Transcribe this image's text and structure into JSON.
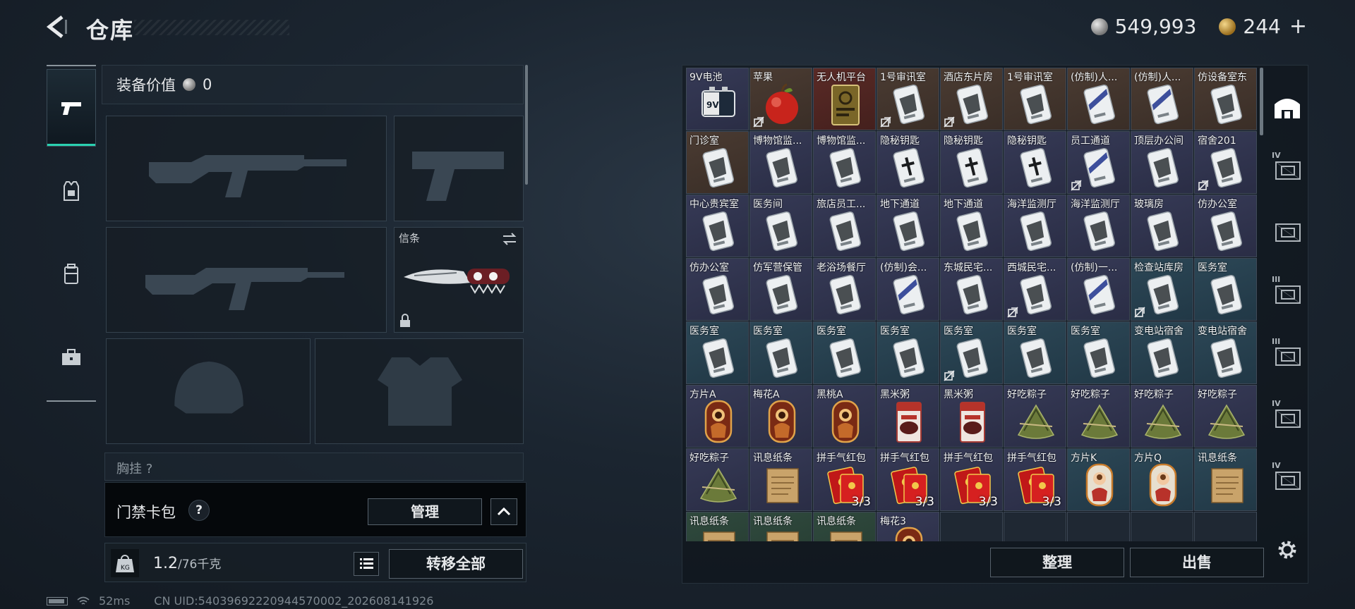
{
  "header": {
    "title": "仓库",
    "silver_amount": "549,993",
    "gold_amount": "244",
    "plus_label": "+"
  },
  "equipment": {
    "value_label": "装备价值",
    "value": "0",
    "melee_slot_label": "信条",
    "chest_hint": "胸挂 ?"
  },
  "keycard": {
    "label": "门禁卡包",
    "help": "?",
    "manage_label": "管理"
  },
  "weight": {
    "current": "1.2",
    "capacity": "/76千克",
    "transfer_all_label": "转移全部"
  },
  "status": {
    "ping": "52ms",
    "uid": "CN UID:5403969222094457000​2_202608141926"
  },
  "storage": {
    "sort_label": "整理",
    "sell_label": "出售",
    "items": [
      {
        "name": "9V电池",
        "bg": "purple",
        "art": "battery",
        "nolink": false,
        "count": ""
      },
      {
        "name": "苹果",
        "bg": "brown",
        "art": "apple",
        "nolink": true,
        "count": ""
      },
      {
        "name": "无人机平台",
        "bg": "red",
        "art": "drone",
        "nolink": false,
        "count": ""
      },
      {
        "name": "1号审讯室",
        "bg": "brown",
        "art": "card",
        "nolink": true,
        "count": ""
      },
      {
        "name": "酒店东片房",
        "bg": "brown",
        "art": "card",
        "nolink": true,
        "count": ""
      },
      {
        "name": "1号审讯室",
        "bg": "brown",
        "art": "card",
        "nolink": false,
        "count": ""
      },
      {
        "name": "(仿制)人...",
        "bg": "brown",
        "art": "card-blue",
        "nolink": false,
        "count": ""
      },
      {
        "name": "(仿制)人...",
        "bg": "brown",
        "art": "card-blue",
        "nolink": false,
        "count": ""
      },
      {
        "name": "仿设备室东",
        "bg": "brown",
        "art": "card",
        "nolink": false,
        "count": ""
      },
      {
        "name": "门诊室",
        "bg": "brown",
        "art": "card",
        "nolink": false,
        "count": ""
      },
      {
        "name": "博物馆监...",
        "bg": "purple",
        "art": "card",
        "nolink": false,
        "count": ""
      },
      {
        "name": "博物馆监...",
        "bg": "purple",
        "art": "card",
        "nolink": false,
        "count": ""
      },
      {
        "name": "隐秘钥匙",
        "bg": "purple",
        "art": "card-cross",
        "nolink": false,
        "count": ""
      },
      {
        "name": "隐秘钥匙",
        "bg": "purple",
        "art": "card-cross",
        "nolink": false,
        "count": ""
      },
      {
        "name": "隐秘钥匙",
        "bg": "purple",
        "art": "card-cross",
        "nolink": false,
        "count": ""
      },
      {
        "name": "员工通道",
        "bg": "purple",
        "art": "card-blue",
        "nolink": true,
        "count": ""
      },
      {
        "name": "顶层办公间",
        "bg": "purple",
        "art": "card",
        "nolink": false,
        "count": ""
      },
      {
        "name": "宿舍201",
        "bg": "purple",
        "art": "card",
        "nolink": true,
        "count": ""
      },
      {
        "name": "中心贵宾室",
        "bg": "purple",
        "art": "card",
        "nolink": false,
        "count": ""
      },
      {
        "name": "医务间",
        "bg": "purple",
        "art": "card",
        "nolink": false,
        "count": ""
      },
      {
        "name": "旅店员工...",
        "bg": "purple",
        "art": "card",
        "nolink": false,
        "count": ""
      },
      {
        "name": "地下通道",
        "bg": "purple",
        "art": "card",
        "nolink": false,
        "count": ""
      },
      {
        "name": "地下通道",
        "bg": "purple",
        "art": "card",
        "nolink": false,
        "count": ""
      },
      {
        "name": "海洋监测厅",
        "bg": "purple",
        "art": "card",
        "nolink": false,
        "count": ""
      },
      {
        "name": "海洋监测厅",
        "bg": "purple",
        "art": "card",
        "nolink": false,
        "count": ""
      },
      {
        "name": "玻璃房",
        "bg": "purple",
        "art": "card",
        "nolink": false,
        "count": ""
      },
      {
        "name": "仿办公室",
        "bg": "purple",
        "art": "card",
        "nolink": false,
        "count": ""
      },
      {
        "name": "仿办公室",
        "bg": "purple",
        "art": "card",
        "nolink": false,
        "count": ""
      },
      {
        "name": "仿军营保管",
        "bg": "purple",
        "art": "card",
        "nolink": false,
        "count": ""
      },
      {
        "name": "老浴场餐厅",
        "bg": "purple",
        "art": "card",
        "nolink": false,
        "count": ""
      },
      {
        "name": "(仿制)会...",
        "bg": "purple",
        "art": "card-blue",
        "nolink": false,
        "count": ""
      },
      {
        "name": "东城民宅...",
        "bg": "purple",
        "art": "card",
        "nolink": false,
        "count": ""
      },
      {
        "name": "西城民宅...",
        "bg": "purple",
        "art": "card",
        "nolink": true,
        "count": ""
      },
      {
        "name": "(仿制)一...",
        "bg": "purple",
        "art": "card-blue",
        "nolink": false,
        "count": ""
      },
      {
        "name": "检查站库房",
        "bg": "teal",
        "art": "card",
        "nolink": true,
        "count": ""
      },
      {
        "name": "医务室",
        "bg": "teal",
        "art": "card",
        "nolink": false,
        "count": ""
      },
      {
        "name": "医务室",
        "bg": "teal",
        "art": "card",
        "nolink": false,
        "count": ""
      },
      {
        "name": "医务室",
        "bg": "teal",
        "art": "card",
        "nolink": false,
        "count": ""
      },
      {
        "name": "医务室",
        "bg": "teal",
        "art": "card",
        "nolink": false,
        "count": ""
      },
      {
        "name": "医务室",
        "bg": "teal",
        "art": "card",
        "nolink": false,
        "count": ""
      },
      {
        "name": "医务室",
        "bg": "teal",
        "art": "card",
        "nolink": true,
        "count": ""
      },
      {
        "name": "医务室",
        "bg": "teal",
        "art": "card",
        "nolink": false,
        "count": ""
      },
      {
        "name": "医务室",
        "bg": "teal",
        "art": "card",
        "nolink": false,
        "count": ""
      },
      {
        "name": "变电站宿舍",
        "bg": "teal",
        "art": "card",
        "nolink": false,
        "count": ""
      },
      {
        "name": "变电站宿舍",
        "bg": "teal",
        "art": "card",
        "nolink": false,
        "count": ""
      },
      {
        "name": "方片A",
        "bg": "purple",
        "art": "tarot",
        "nolink": false,
        "count": ""
      },
      {
        "name": "梅花A",
        "bg": "purple",
        "art": "tarot",
        "nolink": false,
        "count": ""
      },
      {
        "name": "黑桃A",
        "bg": "purple",
        "art": "tarot",
        "nolink": false,
        "count": ""
      },
      {
        "name": "黑米粥",
        "bg": "purple",
        "art": "porridge",
        "nolink": false,
        "count": ""
      },
      {
        "name": "黑米粥",
        "bg": "purple",
        "art": "porridge",
        "nolink": false,
        "count": ""
      },
      {
        "name": "好吃粽子",
        "bg": "purple",
        "art": "zongzi",
        "nolink": false,
        "count": ""
      },
      {
        "name": "好吃粽子",
        "bg": "purple",
        "art": "zongzi",
        "nolink": false,
        "count": ""
      },
      {
        "name": "好吃粽子",
        "bg": "purple",
        "art": "zongzi",
        "nolink": false,
        "count": ""
      },
      {
        "name": "好吃粽子",
        "bg": "purple",
        "art": "zongzi",
        "nolink": false,
        "count": ""
      },
      {
        "name": "好吃粽子",
        "bg": "purple",
        "art": "zongzi",
        "nolink": false,
        "count": ""
      },
      {
        "name": "讯息纸条",
        "bg": "purple",
        "art": "paper",
        "nolink": false,
        "count": ""
      },
      {
        "name": "拼手气红包",
        "bg": "purple",
        "art": "redpacket",
        "nolink": false,
        "count": "3/3"
      },
      {
        "name": "拼手气红包",
        "bg": "purple",
        "art": "redpacket",
        "nolink": false,
        "count": "3/3"
      },
      {
        "name": "拼手气红包",
        "bg": "purple",
        "art": "redpacket",
        "nolink": false,
        "count": "3/3"
      },
      {
        "name": "拼手气红包",
        "bg": "purple",
        "art": "redpacket",
        "nolink": false,
        "count": "3/3"
      },
      {
        "name": "方片K",
        "bg": "teal",
        "art": "tarot2",
        "nolink": false,
        "count": ""
      },
      {
        "name": "方片Q",
        "bg": "teal",
        "art": "tarot2",
        "nolink": false,
        "count": ""
      },
      {
        "name": "讯息纸条",
        "bg": "teal",
        "art": "paper",
        "nolink": false,
        "count": ""
      },
      {
        "name": "讯息纸条",
        "bg": "green",
        "art": "paper",
        "nolink": false,
        "count": ""
      },
      {
        "name": "讯息纸条",
        "bg": "green",
        "art": "paper",
        "nolink": false,
        "count": ""
      },
      {
        "name": "讯息纸条",
        "bg": "green",
        "art": "paper",
        "nolink": false,
        "count": ""
      },
      {
        "name": "梅花3",
        "bg": "purple",
        "art": "tarot",
        "nolink": false,
        "count": ""
      },
      {
        "name": "",
        "bg": "empty",
        "art": "",
        "nolink": false,
        "count": ""
      },
      {
        "name": "",
        "bg": "empty",
        "art": "",
        "nolink": false,
        "count": ""
      },
      {
        "name": "",
        "bg": "empty",
        "art": "",
        "nolink": false,
        "count": ""
      },
      {
        "name": "",
        "bg": "empty",
        "art": "",
        "nolink": false,
        "count": ""
      },
      {
        "name": "",
        "bg": "empty",
        "art": "",
        "nolink": false,
        "count": ""
      }
    ]
  },
  "containers": [
    {
      "tier": "",
      "icon": "safe-box-icon"
    },
    {
      "tier": "IV",
      "icon": "container-icon"
    },
    {
      "tier": "",
      "icon": "container-icon"
    },
    {
      "tier": "III",
      "icon": "container-icon"
    },
    {
      "tier": "III",
      "icon": "container-icon"
    },
    {
      "tier": "IV",
      "icon": "container-icon"
    },
    {
      "tier": "IV",
      "icon": "container-icon"
    }
  ]
}
